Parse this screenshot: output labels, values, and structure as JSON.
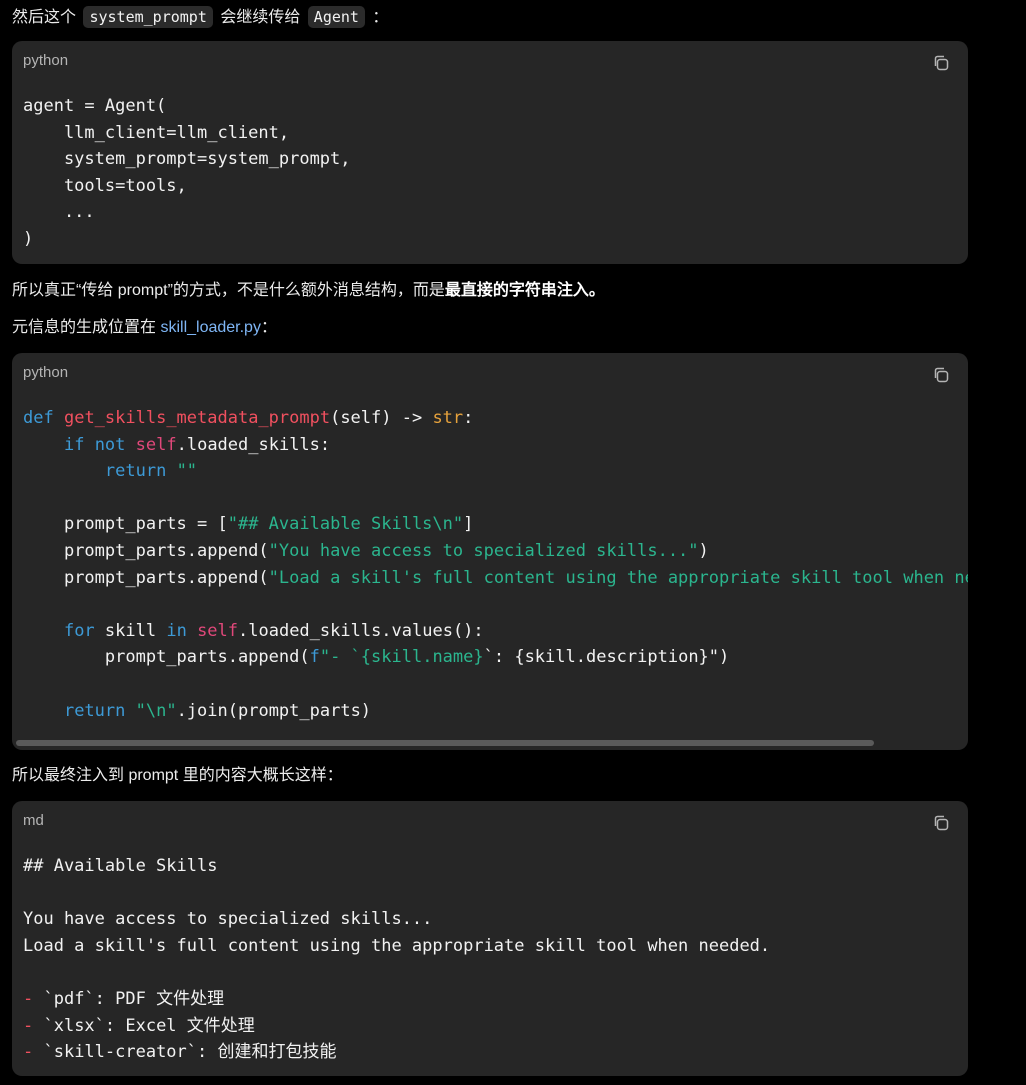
{
  "intro_line": {
    "text_before": "然后这个",
    "code1": "system_prompt",
    "text_mid": "会继续传给",
    "code2": "Agent",
    "text_after": "："
  },
  "block1": {
    "language": "python",
    "lines": [
      "agent = Agent(",
      "    llm_client=llm_client,",
      "    system_prompt=system_prompt,",
      "    tools=tools,",
      "    ...",
      ")"
    ]
  },
  "para2": {
    "text": "所以真正“传给 prompt”的方式，不是什么额外消息结构，而是",
    "strong": "最直接的字符串注入",
    "end": "。"
  },
  "para3": {
    "text": "元信息的生成位置在 ",
    "link": "skill_loader.py",
    "end": "："
  },
  "block2": {
    "language": "python",
    "def_kw": "def",
    "func_name": "get_skills_metadata_prompt",
    "sig_mid": "(self) -> ",
    "ret_type": "str",
    "sig_end": ":",
    "if_kw": "if",
    "not_kw": "not",
    "self_kw": "self",
    "loaded_skills_colon": ".loaded_skills:",
    "return_kw": "return",
    "empty_str": "\"\"",
    "parts_init": "prompt_parts = [",
    "parts_init_str": "\"## Available Skills\\n\"",
    "parts_init_end": "]",
    "append_open": "prompt_parts.append(",
    "append_str1": "\"You have access to specialized skills...\"",
    "append_close": ")",
    "append_str2": "\"Load a skill's full content using the appropriate skill tool when needed.\"",
    "for_kw": "for",
    "skill_var": " skill ",
    "in_kw": "in",
    "values_call": ".loaded_skills.values():",
    "f_prefix": "f",
    "fstr_open": "\"- `",
    "fstr_name": "{skill.name}",
    "fstr_mid": "`: {skill.description}\"",
    "fstr_close": ")",
    "newline_str": "\"\\n\"",
    "join_call": ".join(prompt_parts)"
  },
  "para4": {
    "text": "所以最终注入到 prompt 里的内容大概长这样："
  },
  "block3": {
    "language": "md",
    "heading": "## Available Skills",
    "line1": "You have access to specialized skills...",
    "line2": "Load a skill's full content using the appropriate skill tool when needed.",
    "bullets": [
      {
        "dash": "-",
        "text": " `pdf`: PDF 文件处理"
      },
      {
        "dash": "-",
        "text": " `xlsx`: Excel 文件处理"
      },
      {
        "dash": "-",
        "text": " `skill-creator`: 创建和打包技能"
      }
    ]
  },
  "icons": {
    "copy": "copy-icon"
  },
  "colors": {
    "background": "#000000",
    "code_bg": "#262626",
    "keyword": "#3d9ad6",
    "function": "#f0505f",
    "string": "#2bb58e",
    "type": "#e6a23c",
    "link": "#7fb6f5"
  }
}
